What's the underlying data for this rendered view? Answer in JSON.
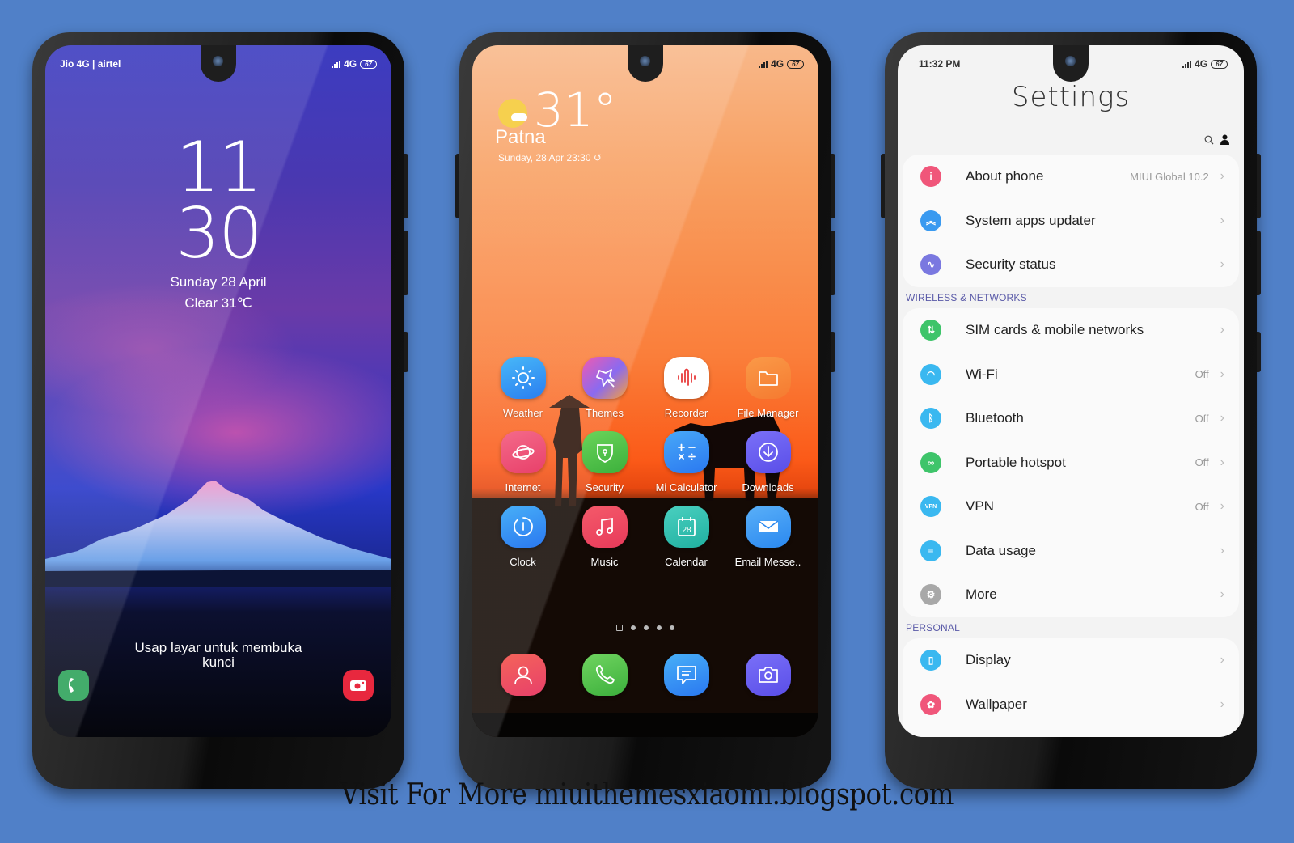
{
  "background_color": "#5080c8",
  "lock_screen": {
    "status": {
      "carrier": "Jio 4G | airtel",
      "network": "4G",
      "battery": "67"
    },
    "clock": {
      "hour": "11",
      "minute": "30"
    },
    "date": "Sunday 28 April",
    "weather": "Clear 31℃",
    "unlock_hint": "Usap layar untuk membuka kunci",
    "shortcuts": {
      "left": "phone-icon",
      "right": "camera-icon"
    },
    "colors": {
      "phone": "#2ea35a",
      "camera": "#e8283e"
    }
  },
  "home_screen": {
    "status": {
      "network": "4G",
      "battery": "67"
    },
    "weather_widget": {
      "temperature": "31°",
      "city": "Patna",
      "datetime": "Sunday, 28 Apr 23:30 ↺",
      "icon": "partly-sunny-icon"
    },
    "apps": [
      {
        "label": "Weather",
        "icon": "sun-icon",
        "color": "#2e9cf0"
      },
      {
        "label": "Themes",
        "icon": "star-brush-icon",
        "color": "#e04ab0"
      },
      {
        "label": "Recorder",
        "icon": "soundwave-icon",
        "color": "#ffffff"
      },
      {
        "label": "File Manager",
        "icon": "folder-icon",
        "color": "#f58a3a"
      },
      {
        "label": "Internet",
        "icon": "planet-icon",
        "color": "#ec4a7a"
      },
      {
        "label": "Security",
        "icon": "shield-icon",
        "color": "#4cc44a"
      },
      {
        "label": "Mi Calculator",
        "icon": "calculator-icon",
        "color": "#2e8cf0"
      },
      {
        "label": "Downloads",
        "icon": "download-icon",
        "color": "#6a5ef0"
      },
      {
        "label": "Clock",
        "icon": "clock-icon",
        "color": "#2e8cf0"
      },
      {
        "label": "Music",
        "icon": "music-note-icon",
        "color": "#ec4060"
      },
      {
        "label": "Calendar",
        "icon": "calendar-icon",
        "color": "#2ec0b0"
      },
      {
        "label": "Email Messe..",
        "icon": "envelope-icon",
        "color": "#3a9af0"
      }
    ],
    "calendar_day": "28",
    "page_count": 4,
    "current_page": "home",
    "dock": [
      {
        "name": "contacts",
        "icon": "person-icon",
        "color": "#ec4a5a"
      },
      {
        "name": "phone",
        "icon": "phone-icon",
        "color": "#4cc44a"
      },
      {
        "name": "messages",
        "icon": "message-icon",
        "color": "#2e8cf0"
      },
      {
        "name": "camera",
        "icon": "camera-icon",
        "color": "#6a5ef0"
      }
    ]
  },
  "settings_screen": {
    "status": {
      "time": "11:32 PM",
      "network": "4G",
      "battery": "67"
    },
    "title": "Settings",
    "toolbar": {
      "search": "search-icon",
      "account": "person-icon"
    },
    "groups": [
      {
        "header": "",
        "items": [
          {
            "label": "About phone",
            "value": "MIUI Global 10.2",
            "icon": "info-icon",
            "color": "#f0567a",
            "glyph": "i"
          },
          {
            "label": "System apps updater",
            "value": "",
            "icon": "double-chevron-up-icon",
            "color": "#3a9af0",
            "glyph": "︽"
          },
          {
            "label": "Security status",
            "value": "",
            "icon": "shield-pulse-icon",
            "color": "#7a78e0",
            "glyph": "∿"
          }
        ]
      },
      {
        "header": "WIRELESS & NETWORKS",
        "items": [
          {
            "label": "SIM cards & mobile networks",
            "value": "",
            "icon": "sim-arrows-icon",
            "color": "#3ec46a",
            "glyph": "⇅"
          },
          {
            "label": "Wi-Fi",
            "value": "Off",
            "icon": "wifi-icon",
            "color": "#3ab8f0",
            "glyph": "◠"
          },
          {
            "label": "Bluetooth",
            "value": "Off",
            "icon": "bluetooth-icon",
            "color": "#3ab8f0",
            "glyph": "ᛒ"
          },
          {
            "label": "Portable hotspot",
            "value": "Off",
            "icon": "hotspot-link-icon",
            "color": "#3ec46a",
            "glyph": "∞"
          },
          {
            "label": "VPN",
            "value": "Off",
            "icon": "vpn-icon",
            "color": "#3ab8f0",
            "glyph": "VPN"
          },
          {
            "label": "Data usage",
            "value": "",
            "icon": "list-icon",
            "color": "#3ab8f0",
            "glyph": "≡"
          },
          {
            "label": "More",
            "value": "",
            "icon": "gear-icon",
            "color": "#a8a8a8",
            "glyph": "⚙"
          }
        ]
      },
      {
        "header": "PERSONAL",
        "items": [
          {
            "label": "Display",
            "value": "",
            "icon": "display-icon",
            "color": "#3ab8f0",
            "glyph": "▯"
          },
          {
            "label": "Wallpaper",
            "value": "",
            "icon": "wallpaper-flower-icon",
            "color": "#f0567a",
            "glyph": "✿"
          }
        ]
      }
    ],
    "chevron": "›",
    "section_color": "#5a5aa8"
  },
  "footer": {
    "text": "Visit For More miuithemesxiaomi.blogspot.com"
  }
}
